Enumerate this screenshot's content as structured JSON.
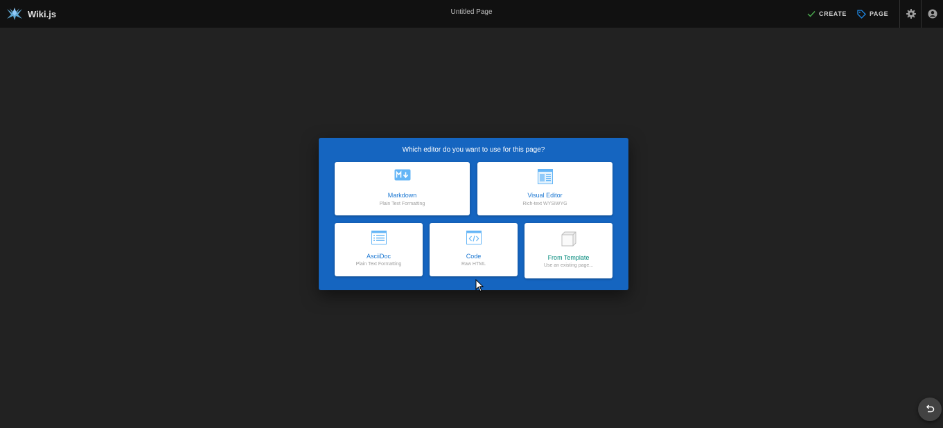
{
  "header": {
    "brand_name": "Wiki.js",
    "page_title": "Untitled Page",
    "create_label": "CREATE",
    "page_label": "PAGE"
  },
  "dialog": {
    "title": "Which editor do you want to use for this page?",
    "editors": [
      {
        "title": "Markdown",
        "subtitle": "Plain Text Formatting",
        "icon": "markdown-icon"
      },
      {
        "title": "Visual Editor",
        "subtitle": "Rich-text WYSIWYG",
        "icon": "visual-editor-icon"
      },
      {
        "title": "AsciiDoc",
        "subtitle": "Plain Text Formatting",
        "icon": "asciidoc-icon"
      },
      {
        "title": "Code",
        "subtitle": "Raw HTML",
        "icon": "code-icon"
      },
      {
        "title": "From Template",
        "subtitle": "Use an existing page...",
        "icon": "template-cube-icon"
      }
    ]
  },
  "colors": {
    "background": "#222222",
    "topbar": "#111111",
    "dialog": "#1565c0",
    "card_title_blue": "#1976d2",
    "card_title_teal": "#00897b",
    "create_check": "#4caf50",
    "page_tag": "#1e88e5"
  },
  "icons": {
    "brand": "wikijs-logo-icon",
    "create": "check-icon",
    "page": "tag-icon",
    "settings": "gear-icon",
    "account": "account-circle-icon",
    "fab": "undo-icon"
  }
}
